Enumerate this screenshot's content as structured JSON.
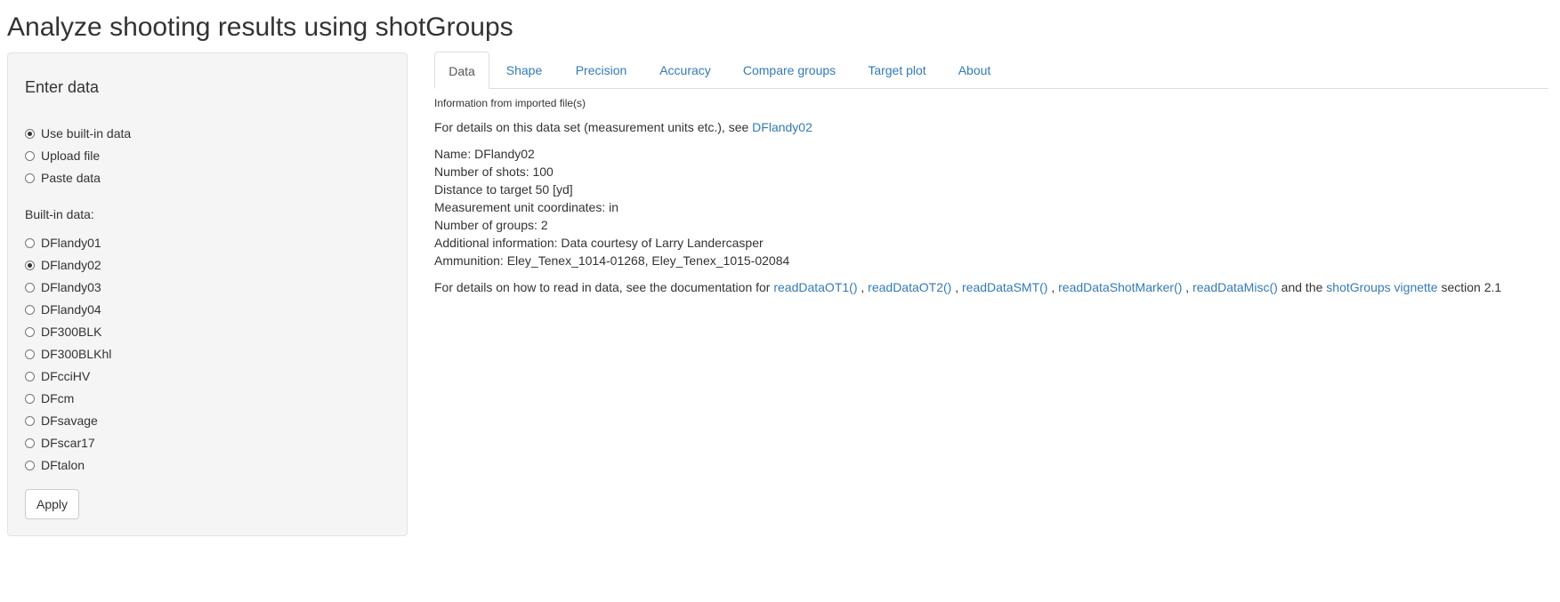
{
  "page": {
    "title": "Analyze shooting results using shotGroups"
  },
  "sidebar": {
    "heading": "Enter data",
    "source_options": [
      {
        "label": "Use built-in data",
        "checked": true
      },
      {
        "label": "Upload file",
        "checked": false
      },
      {
        "label": "Paste data",
        "checked": false
      }
    ],
    "builtin_label": "Built-in data:",
    "datasets": [
      {
        "label": "DFlandy01",
        "checked": false
      },
      {
        "label": "DFlandy02",
        "checked": true
      },
      {
        "label": "DFlandy03",
        "checked": false
      },
      {
        "label": "DFlandy04",
        "checked": false
      },
      {
        "label": "DF300BLK",
        "checked": false
      },
      {
        "label": "DF300BLKhl",
        "checked": false
      },
      {
        "label": "DFcciHV",
        "checked": false
      },
      {
        "label": "DFcm",
        "checked": false
      },
      {
        "label": "DFsavage",
        "checked": false
      },
      {
        "label": "DFscar17",
        "checked": false
      },
      {
        "label": "DFtalon",
        "checked": false
      }
    ],
    "apply_label": "Apply"
  },
  "tabs": [
    {
      "label": "Data",
      "active": true
    },
    {
      "label": "Shape",
      "active": false
    },
    {
      "label": "Precision",
      "active": false
    },
    {
      "label": "Accuracy",
      "active": false
    },
    {
      "label": "Compare groups",
      "active": false
    },
    {
      "label": "Target plot",
      "active": false
    },
    {
      "label": "About",
      "active": false
    }
  ],
  "main": {
    "info_heading": "Information from imported file(s)",
    "details_prefix": "For details on this data set (measurement units etc.), see ",
    "details_link": "DFlandy02",
    "info_lines": [
      "Name: DFlandy02",
      "Number of shots: 100",
      "Distance to target 50 [yd]",
      "Measurement unit coordinates: in",
      "Number of groups: 2",
      "Additional information: Data courtesy of Larry Landercasper",
      "Ammunition: Eley_Tenex_1014-01268, Eley_Tenex_1015-02084"
    ],
    "howto": {
      "prefix": "For details on how to read in data, see the documentation for ",
      "link1": "readDataOT1()",
      "sep1": " , ",
      "link2": "readDataOT2()",
      "sep2": " , ",
      "link3": "readDataSMT()",
      "sep3": " , ",
      "link4": "readDataShotMarker()",
      "sep4": " , ",
      "link5": "readDataMisc()",
      "mid": " and the ",
      "link6": "shotGroups vignette",
      "suffix": " section 2.1"
    }
  },
  "colors": {
    "link": "#337ab7",
    "text": "#333333",
    "panel": "#f5f5f5"
  }
}
